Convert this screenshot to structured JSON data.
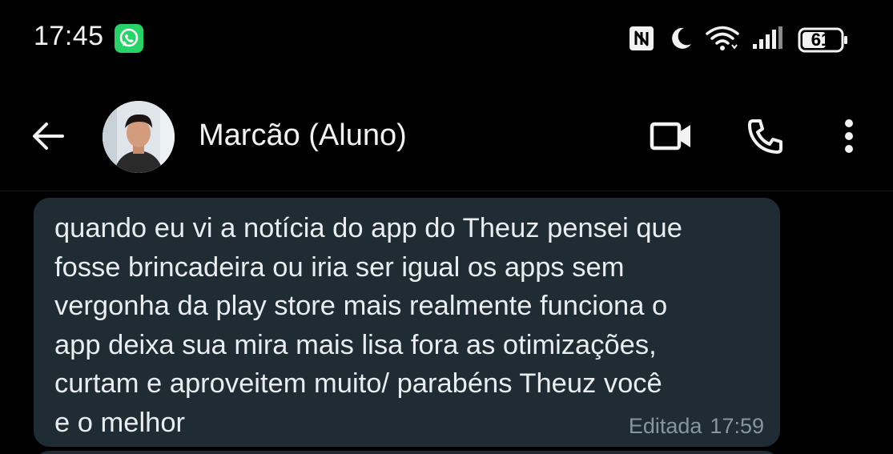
{
  "status_bar": {
    "time": "17:45",
    "battery_level": "61",
    "icons": [
      "whatsapp-notification-icon",
      "nfc-icon",
      "do-not-disturb-moon-icon",
      "wifi-icon",
      "signal-icon",
      "battery-icon"
    ]
  },
  "app_bar": {
    "contact_name": "Marcão (Aluno)",
    "icons": [
      "back-arrow-icon",
      "video-call-icon",
      "phone-icon",
      "more-vert-icon"
    ]
  },
  "message": {
    "text": "quando eu vi a notícia do app do Theuz pensei que\nfosse brincadeira ou iria ser igual os apps sem\nvergonha da play store mais realmente funciona o\napp  deixa sua mira mais lisa fora as otimizações,\ncurtam e aproveitem muito/ parabéns Theuz você\ne o melhor",
    "edited_label": "Editada",
    "time": "17:59"
  },
  "colors": {
    "background": "#000000",
    "bubble": "#1f2c33",
    "text": "#e9edef",
    "meta": "#8696a0",
    "whatsapp_green": "#25d366"
  }
}
